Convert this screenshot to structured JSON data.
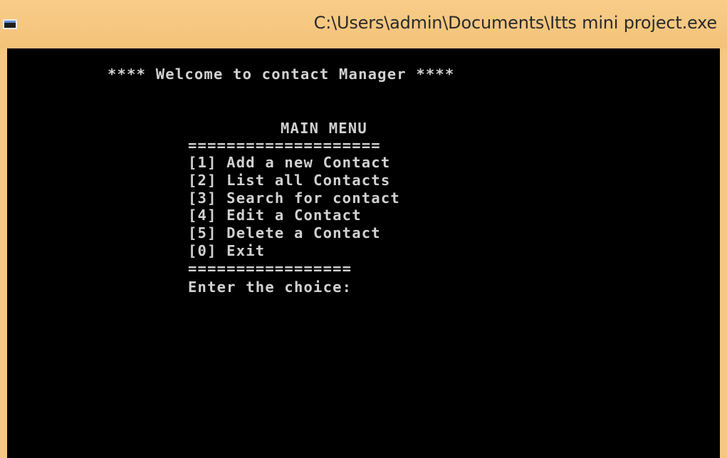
{
  "window": {
    "title": "C:\\Users\\admin\\Documents\\Itts mini project.exe",
    "icon": "console-window-icon",
    "titlebar_color": "#f6c780",
    "console_background": "#000000",
    "console_text_color": "#d2d2d2"
  },
  "console": {
    "welcome": "**** Welcome to contact Manager ****",
    "menu_title": "MAIN MENU",
    "separator_top": "====================",
    "menu_items": [
      "[1] Add a new Contact",
      "[2] List all Contacts",
      "[3] Search for contact",
      "[4] Edit a Contact",
      "[5] Delete a Contact",
      "[0] Exit"
    ],
    "separator_bottom": "=================",
    "prompt": "Enter the choice:"
  }
}
